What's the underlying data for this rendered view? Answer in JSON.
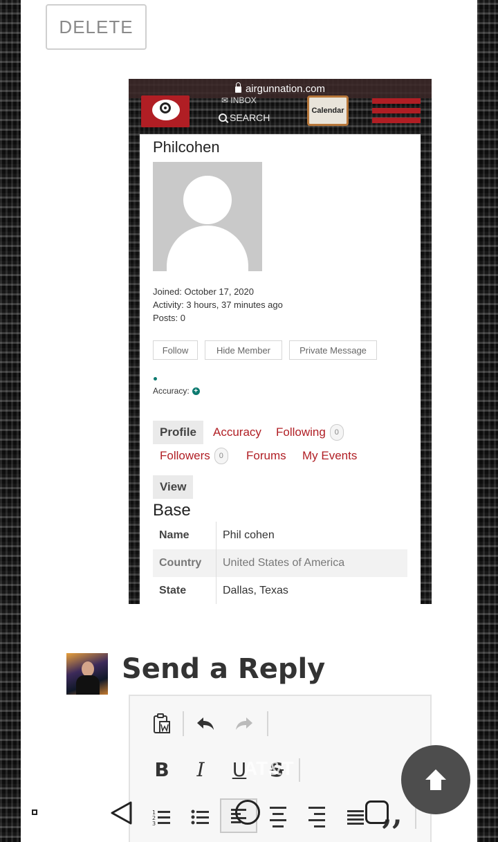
{
  "actions": {
    "delete_label": "DELETE"
  },
  "embedded_screenshot": {
    "url": "airgunnation.com",
    "nav": {
      "inbox": "INBOX",
      "search": "SEARCH",
      "calendar": "Calendar"
    },
    "profile": {
      "username": "Philcohen",
      "joined": "Joined: October 17, 2020",
      "activity": "Activity: 3 hours, 37 minutes ago",
      "posts": "Posts: 0",
      "buttons": [
        "Follow",
        "Hide Member",
        "Private Message"
      ],
      "accuracy_label": "Accuracy:",
      "tabs": {
        "profile": "Profile",
        "accuracy": "Accuracy",
        "following": "Following",
        "following_count": "0",
        "followers": "Followers",
        "followers_count": "0",
        "forums": "Forums",
        "my_events": "My Events",
        "view": "View"
      },
      "section_title": "Base",
      "fields": [
        {
          "key": "Name",
          "value": "Phil cohen"
        },
        {
          "key": "Country",
          "value": "United States of America"
        },
        {
          "key": "State",
          "value": "Dallas, Texas"
        }
      ]
    }
  },
  "reply": {
    "title": "Send a Reply",
    "toolbar": {
      "bold": "B",
      "italic": "I",
      "underline": "U",
      "strike": "S"
    }
  },
  "overlay": {
    "ghost_text": "AT&T"
  },
  "icons": {
    "paste": "paste-word-icon",
    "undo": "undo-icon",
    "redo": "redo-icon",
    "numbered_list": "numbered-list-icon",
    "bullet_list": "bullet-list-icon",
    "align_left": "align-left-icon",
    "align_center": "align-center-icon",
    "align_right": "align-right-icon",
    "justify": "justify-icon",
    "quote": "quote-icon",
    "scroll_top": "arrow-up-icon"
  },
  "colors": {
    "brand_red": "#b01e24",
    "teal": "#0d7a70",
    "scroll_button": "#4d4d4d"
  }
}
